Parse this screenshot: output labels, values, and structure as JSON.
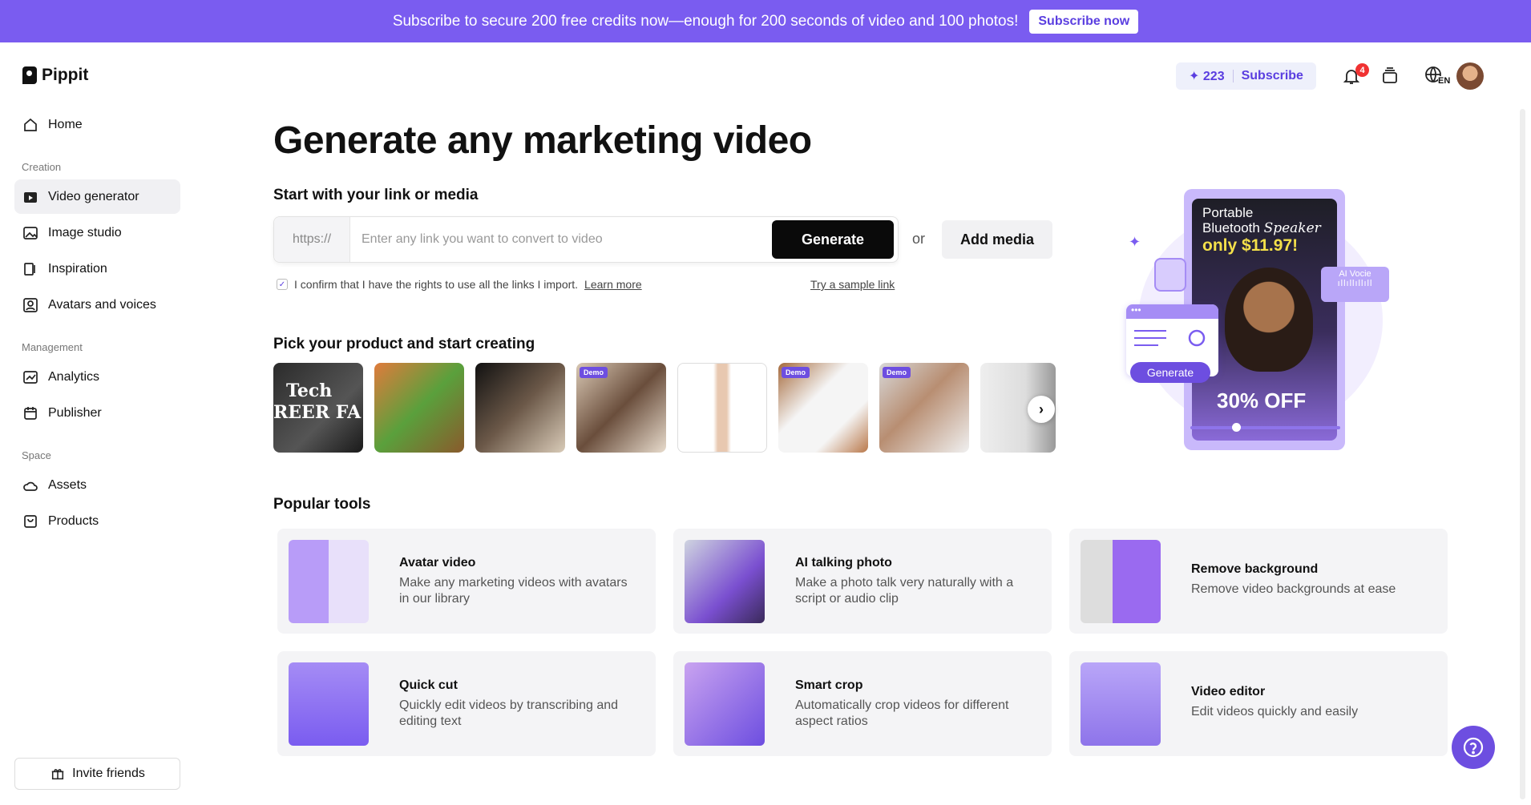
{
  "banner": {
    "text": "Subscribe to secure 200 free credits now—enough for 200 seconds of video and 100 photos!",
    "button": "Subscribe now"
  },
  "app": {
    "name": "Pippit"
  },
  "sidebar": {
    "home": "Home",
    "sections": [
      "Creation",
      "Management",
      "Space"
    ],
    "creation": [
      "Video generator",
      "Image studio",
      "Inspiration",
      "Avatars and voices"
    ],
    "management": [
      "Analytics",
      "Publisher"
    ],
    "space": [
      "Assets",
      "Products"
    ],
    "invite": "Invite friends"
  },
  "header": {
    "credits": "223",
    "subscribe": "Subscribe",
    "notifications": "4",
    "language": "EN"
  },
  "main": {
    "title": "Generate any marketing video",
    "subtitle": "Start with your link or media",
    "prefix": "https://",
    "placeholder": "Enter any link you want to convert to video",
    "generate": "Generate",
    "or": "or",
    "add_media": "Add media",
    "confirm": "I confirm that I have the rights to use all the links I import.",
    "learn_more": "Learn more",
    "sample": "Try a sample link",
    "pick_title": "Pick your product and start creating",
    "demo": "Demo",
    "popular_title": "Popular tools"
  },
  "hero": {
    "line1": "Portable",
    "line2": "Bluetooth",
    "line2b": "Speaker",
    "price": "only $11.97!",
    "discount": "30% OFF",
    "generate": "Generate",
    "ai_voice": "AI Vocie"
  },
  "thumbs": [
    {
      "text1": "Tech",
      "text2": "REER FA",
      "demo": false
    },
    {
      "demo": false
    },
    {
      "demo": false
    },
    {
      "demo": true
    },
    {
      "demo": false
    },
    {
      "demo": true
    },
    {
      "demo": true
    },
    {
      "demo": false
    }
  ],
  "tools": [
    {
      "title": "Avatar video",
      "desc": "Make any marketing videos with avatars in our library"
    },
    {
      "title": "AI talking photo",
      "desc": "Make a photo talk very naturally with a script or audio clip"
    },
    {
      "title": "Remove background",
      "desc": "Remove video backgrounds at ease"
    },
    {
      "title": "Quick cut",
      "desc": "Quickly edit videos by transcribing and editing text"
    },
    {
      "title": "Smart crop",
      "desc": "Automatically crop videos for different aspect ratios"
    },
    {
      "title": "Video editor",
      "desc": "Edit videos quickly and easily"
    }
  ],
  "colors": {
    "accent": "#7a5cf0",
    "accent_dark": "#5a3ee0"
  }
}
